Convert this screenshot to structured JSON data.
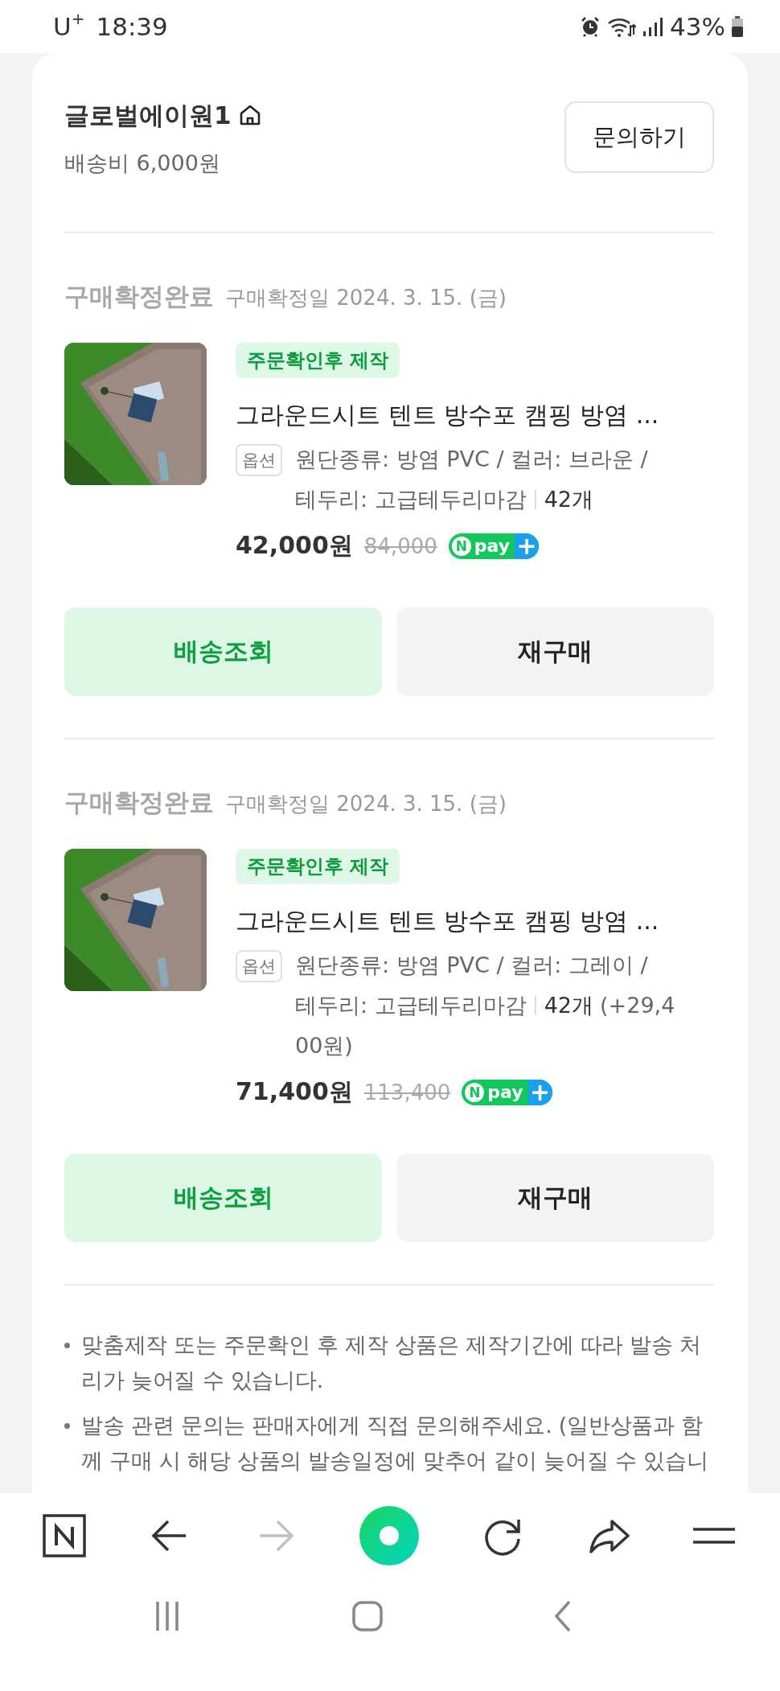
{
  "status_bar": {
    "carrier": "U$^{+}$",
    "time": "18:39",
    "battery": "43%"
  },
  "seller": {
    "name": "글로벌에이원1",
    "shipping_fee": "배송비 6,000원",
    "inquiry_button": "문의하기"
  },
  "orders": [
    {
      "status": "구매확정완료",
      "date": "구매확정일 2024. 3. 15. (금)",
      "badge": "주문확인후 제작",
      "title": "그라운드시트 텐트 방수포 캠핑 방염 ...",
      "option_label": "옵션",
      "option_lines": [
        "원단종류: 방염 PVC / 컬러: 브라운 /",
        "테두리: 고급테두리마감"
      ],
      "quantity": "42개",
      "price": "42,000원",
      "original_price": "84,000",
      "npay": {
        "mark": "N",
        "text": "pay",
        "plus": "+"
      },
      "buttons": [
        {
          "label": "배송조회",
          "kind": "primary"
        },
        {
          "label": "재구매",
          "kind": "secondary"
        }
      ]
    },
    {
      "status": "구매확정완료",
      "date": "구매확정일 2024. 3. 15. (금)",
      "badge": "주문확인후 제작",
      "title": "그라운드시트 텐트 방수포 캠핑 방염 ...",
      "option_label": "옵션",
      "option_lines": [
        "원단종류: 방염 PVC / 컬러: 그레이 /",
        "테두리: 고급테두리마감"
      ],
      "quantity": "42개",
      "extra_lines": [
        "(+29,4",
        "00원)"
      ],
      "price": "71,400원",
      "original_price": "113,400",
      "npay": {
        "mark": "N",
        "text": "pay",
        "plus": "+"
      },
      "buttons": [
        {
          "label": "배송조회",
          "kind": "primary"
        },
        {
          "label": "재구매",
          "kind": "secondary"
        }
      ]
    }
  ],
  "notes": [
    "맞춤제작 또는 주문확인 후 제작 상품은 제작기간에 따라 발송 처리가 늦어질 수 있습니다.",
    "발송 관련 문의는 판매자에게 직접 문의해주세요. (일반상품과 함께 구매 시 해당 상품의 발송일정에 맞추어 같이 늦어질 수 있습니"
  ],
  "toolbar": [
    {
      "kind": "naver",
      "disabled": false
    },
    {
      "kind": "back",
      "disabled": false
    },
    {
      "kind": "forward",
      "disabled": true
    },
    {
      "kind": "home",
      "disabled": false
    },
    {
      "kind": "reload",
      "disabled": false
    },
    {
      "kind": "share",
      "disabled": false
    },
    {
      "kind": "menu",
      "disabled": false
    }
  ]
}
